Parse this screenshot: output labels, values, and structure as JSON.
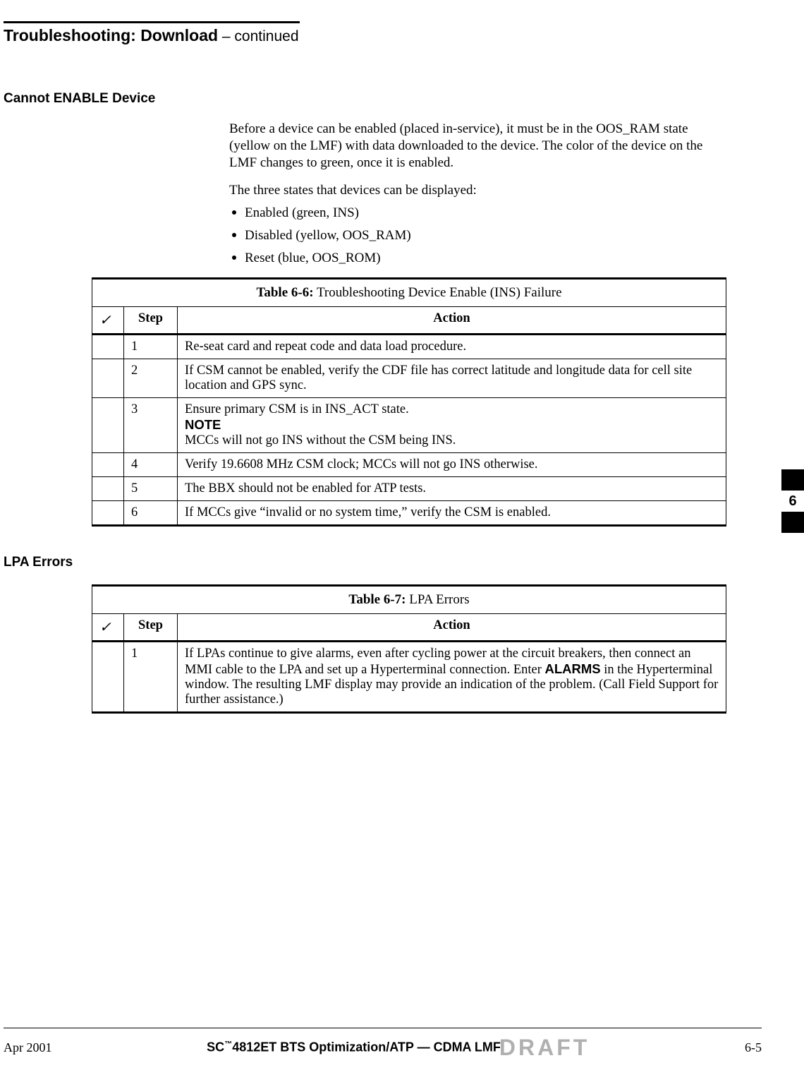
{
  "header": {
    "title_strong": "Troubleshooting: Download",
    "title_light": " – continued"
  },
  "section1": {
    "heading": "Cannot ENABLE Device",
    "para1": "Before a device can be enabled (placed in-service), it must be in the OOS_RAM state (yellow on the LMF) with data downloaded to the device. The color of the device on the LMF changes to green, once it is enabled.",
    "para2": "The three states that devices can be displayed:",
    "states": [
      "Enabled (green, INS)",
      "Disabled (yellow, OOS_RAM)",
      "Reset (blue, OOS_ROM)"
    ]
  },
  "table66": {
    "caption_label": "Table 6-6:",
    "caption_text": " Troubleshooting Device Enable (INS) Failure",
    "check_header": "✓",
    "step_header": "Step",
    "action_header": "Action",
    "rows": [
      {
        "step": "1",
        "action": "Re-seat card and repeat code and data load procedure."
      },
      {
        "step": "2",
        "action": "If CSM cannot be enabled, verify the CDF file has correct latitude and longitude data for cell site location and GPS sync."
      },
      {
        "step": "3",
        "action_line1": "Ensure primary CSM is in INS_ACT state.",
        "note_label": "NOTE",
        "note_body": "MCCs will not go INS without the CSM being INS."
      },
      {
        "step": "4",
        "action": "Verify 19.6608 MHz CSM clock; MCCs will not go INS otherwise."
      },
      {
        "step": "5",
        "action": "The BBX should not be enabled for ATP tests."
      },
      {
        "step": "6",
        "action": "If MCCs give “invalid or no system time,” verify the CSM is enabled."
      }
    ]
  },
  "section2": {
    "heading": "LPA Errors"
  },
  "table67": {
    "caption_label": "Table 6-7:",
    "caption_text": " LPA Errors",
    "check_header": "✓",
    "step_header": "Step",
    "action_header": "Action",
    "rows": [
      {
        "step": "1",
        "action_pre": "If LPAs continue to give alarms, even after cycling power at the circuit breakers, then connect an MMI cable to the LPA and set up a Hyperterminal connection. Enter ",
        "action_bold": "ALARMS",
        "action_post": " in the Hyperterminal window. The resulting LMF display may provide an indication of the problem. (Call Field Support for further assistance.)"
      }
    ]
  },
  "side_tab": "6",
  "footer": {
    "left": "Apr 2001",
    "center_pre": "SC",
    "center_tm": "™",
    "center_post": "4812ET BTS Optimization/ATP — CDMA LMF",
    "draft": "DRAFT",
    "right": "6-5"
  }
}
